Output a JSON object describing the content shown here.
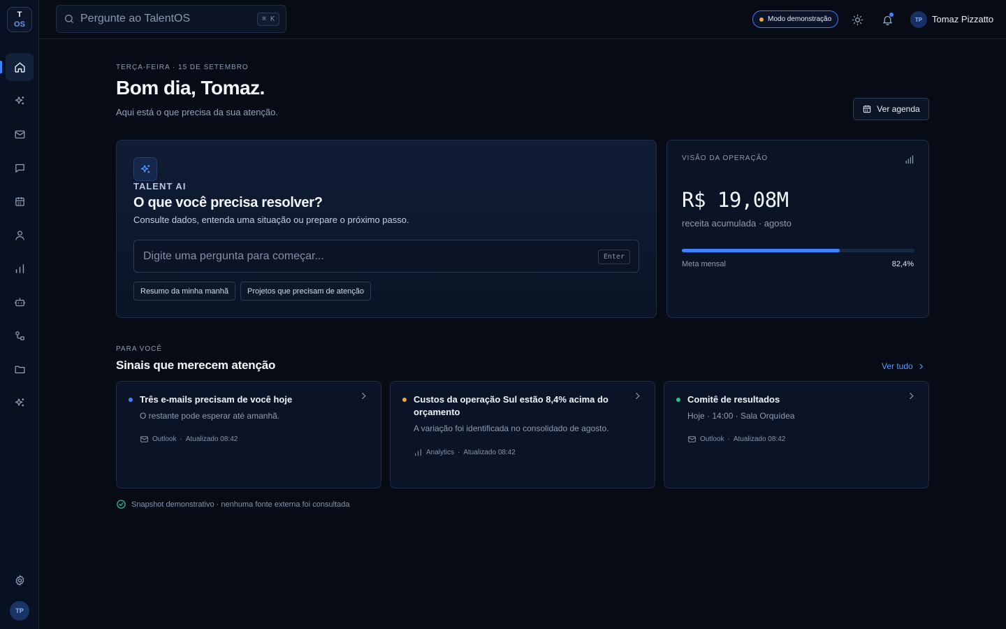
{
  "sidebar": {
    "logo": {
      "line1": "T",
      "line2": "OS"
    },
    "items": [
      {
        "name": "home",
        "icon": "home-icon",
        "active": true
      },
      {
        "name": "ai",
        "icon": "sparkles-icon"
      },
      {
        "name": "mail",
        "icon": "mail-icon"
      },
      {
        "name": "chat",
        "icon": "chat-icon"
      },
      {
        "name": "calendar",
        "icon": "calendar-icon"
      },
      {
        "name": "people",
        "icon": "user-icon"
      },
      {
        "name": "analytics",
        "icon": "bar-chart-icon"
      },
      {
        "name": "bot",
        "icon": "bot-icon"
      },
      {
        "name": "workflows",
        "icon": "workflow-icon"
      },
      {
        "name": "files",
        "icon": "folder-icon"
      },
      {
        "name": "automations",
        "icon": "sparkles-icon"
      }
    ],
    "settings_icon": "gear-icon",
    "avatar_initials": "TP"
  },
  "topbar": {
    "search_placeholder": "Pergunte ao TalentOS",
    "search_shortcut": "⌘ K",
    "demo_mode": "Modo demonstração",
    "user_initials": "TP",
    "user_name": "Tomaz Pizzatto"
  },
  "greeting": {
    "date": "TERÇA-FEIRA · 15 DE SETEMBRO",
    "title": "Bom dia, Tomaz.",
    "subtitle": "Aqui está o que precisa da sua atenção.",
    "agenda_button": "Ver agenda"
  },
  "ai_card": {
    "label": "TALENT AI",
    "title": "O que você precisa resolver?",
    "subtitle": "Consulte dados, entenda uma situação ou prepare o próximo passo.",
    "input_placeholder": "Digite uma pergunta para começar...",
    "enter_hint": "Enter",
    "chips": [
      "Resumo da minha manhã",
      "Projetos que precisam de atenção"
    ]
  },
  "operation": {
    "eyebrow": "VISÃO DA OPERAÇÃO",
    "value": "R$ 19,08M",
    "caption": "receita acumulada · agosto",
    "progress_label": "Meta mensal",
    "progress_text": "82,4%",
    "progress_fraction": 0.68
  },
  "signals": {
    "eyebrow": "PARA VOCÊ",
    "title": "Sinais que merecem atenção",
    "see_all": "Ver tudo",
    "cards": [
      {
        "title": "Três e-mails precisam de você hoje",
        "description": "O restante pode esperar até amanhã.",
        "source": "Outlook",
        "updated": "Atualizado 08:42",
        "dot_color": "#3d82ff",
        "source_icon": "mail-icon"
      },
      {
        "title": "Custos da operação Sul estão 8,4% acima do orçamento",
        "description": "A variação foi identificada no consolidado de agosto.",
        "source": "Analytics",
        "updated": "Atualizado 08:42",
        "dot_color": "#f0a63a",
        "source_icon": "bar-chart-icon"
      },
      {
        "title": "Comitê de resultados",
        "description": "Hoje · 14:00 · Sala Orquídea",
        "source": "Outlook",
        "updated": "Atualizado 08:42",
        "dot_color": "#2fbf8f",
        "source_icon": "mail-icon"
      }
    ]
  },
  "footnote": "Snapshot demonstrativo · nenhuma fonte externa foi consultada",
  "colors": {
    "accent": "#3d82ff",
    "background": "#060b16",
    "warning": "#f0a63a",
    "success": "#2fbf8f"
  }
}
